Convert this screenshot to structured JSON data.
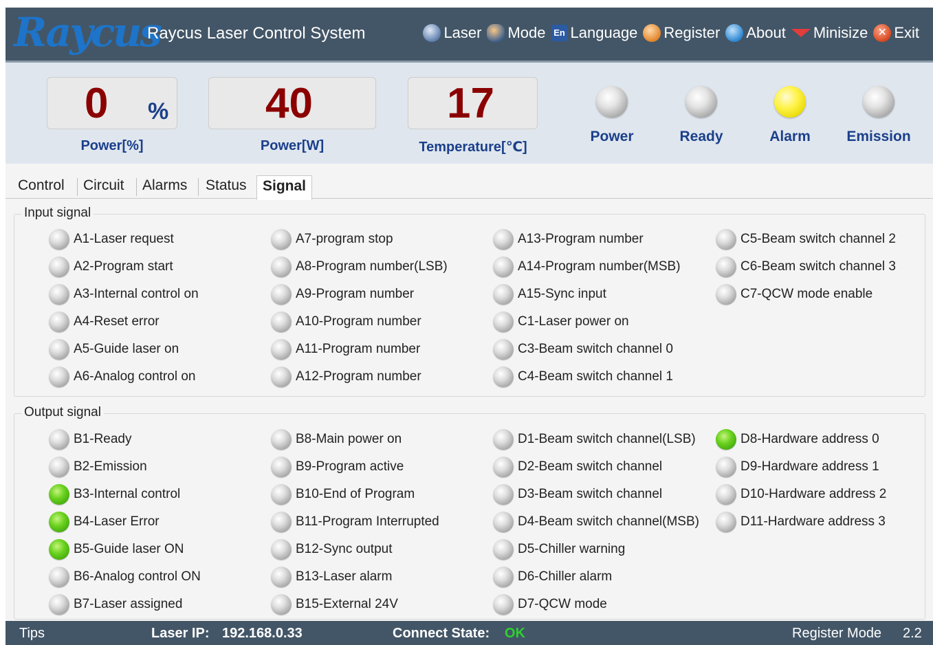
{
  "titlebar": {
    "logo_text": "Raycus",
    "app_title": "Raycus Laser Control System",
    "menu": [
      {
        "label": "Laser",
        "icon": "laser-icon"
      },
      {
        "label": "Mode",
        "icon": "mode-icon"
      },
      {
        "label": "Language",
        "icon": "language-icon",
        "badge": "En"
      },
      {
        "label": "Register",
        "icon": "register-icon"
      },
      {
        "label": "About",
        "icon": "about-icon"
      },
      {
        "label": "Minisize",
        "icon": "minimize-icon"
      },
      {
        "label": "Exit",
        "icon": "exit-icon"
      }
    ]
  },
  "gauges": {
    "power_percent": {
      "value": "0",
      "unit": "%",
      "label": "Power[%]"
    },
    "power_w": {
      "value": "40",
      "label": "Power[W]"
    },
    "temperature": {
      "value": "17",
      "label": "Temperature[℃]"
    },
    "indicators": [
      {
        "label": "Power",
        "state": "off"
      },
      {
        "label": "Ready",
        "state": "off"
      },
      {
        "label": "Alarm",
        "state": "yellow"
      },
      {
        "label": "Emission",
        "state": "off"
      }
    ]
  },
  "tabs": [
    {
      "label": "Control",
      "active": false
    },
    {
      "label": "Circuit",
      "active": false
    },
    {
      "label": "Alarms",
      "active": false
    },
    {
      "label": "Status",
      "active": false
    },
    {
      "label": "Signal",
      "active": true
    }
  ],
  "input_signal": {
    "title": "Input signal",
    "columns": [
      [
        {
          "label": "A1-Laser request",
          "on": false
        },
        {
          "label": "A2-Program start",
          "on": false
        },
        {
          "label": "A3-Internal control on",
          "on": false
        },
        {
          "label": "A4-Reset error",
          "on": false
        },
        {
          "label": "A5-Guide laser on",
          "on": false
        },
        {
          "label": "A6-Analog control on",
          "on": false
        }
      ],
      [
        {
          "label": "A7-program stop",
          "on": false
        },
        {
          "label": "A8-Program number(LSB)",
          "on": false
        },
        {
          "label": "A9-Program number",
          "on": false
        },
        {
          "label": "A10-Program number",
          "on": false
        },
        {
          "label": "A11-Program number",
          "on": false
        },
        {
          "label": "A12-Program number",
          "on": false
        }
      ],
      [
        {
          "label": "A13-Program number",
          "on": false
        },
        {
          "label": "A14-Program number(MSB)",
          "on": false
        },
        {
          "label": "A15-Sync input",
          "on": false
        },
        {
          "label": "C1-Laser power on",
          "on": false
        },
        {
          "label": "C3-Beam switch channel 0",
          "on": false
        },
        {
          "label": "C4-Beam switch channel 1",
          "on": false
        }
      ],
      [
        {
          "label": "C5-Beam switch channel 2",
          "on": false
        },
        {
          "label": "C6-Beam switch channel 3",
          "on": false
        },
        {
          "label": "C7-QCW mode enable",
          "on": false
        }
      ]
    ]
  },
  "output_signal": {
    "title": "Output signal",
    "columns": [
      [
        {
          "label": "B1-Ready",
          "on": false
        },
        {
          "label": "B2-Emission",
          "on": false
        },
        {
          "label": "B3-Internal control",
          "on": true
        },
        {
          "label": "B4-Laser Error",
          "on": true
        },
        {
          "label": "B5-Guide laser ON",
          "on": true
        },
        {
          "label": "B6-Analog control ON",
          "on": false
        },
        {
          "label": "B7-Laser assigned",
          "on": false
        }
      ],
      [
        {
          "label": "B8-Main power on",
          "on": false
        },
        {
          "label": "B9-Program active",
          "on": false
        },
        {
          "label": "B10-End of Program",
          "on": false
        },
        {
          "label": "B11-Program Interrupted",
          "on": false
        },
        {
          "label": "B12-Sync output",
          "on": false
        },
        {
          "label": "B13-Laser alarm",
          "on": false
        },
        {
          "label": "B15-External 24V",
          "on": false
        }
      ],
      [
        {
          "label": "D1-Beam switch channel(LSB)",
          "on": false
        },
        {
          "label": "D2-Beam switch channel",
          "on": false
        },
        {
          "label": "D3-Beam switch channel",
          "on": false
        },
        {
          "label": "D4-Beam switch channel(MSB)",
          "on": false
        },
        {
          "label": "D5-Chiller warning",
          "on": false
        },
        {
          "label": "D6-Chiller alarm",
          "on": false
        },
        {
          "label": "D7-QCW mode",
          "on": false
        }
      ],
      [
        {
          "label": "D8-Hardware address 0",
          "on": true
        },
        {
          "label": "D9-Hardware address 1",
          "on": false
        },
        {
          "label": "D10-Hardware address 2",
          "on": false
        },
        {
          "label": "D11-Hardware address 3",
          "on": false
        }
      ]
    ]
  },
  "statusbar": {
    "tips": "Tips",
    "ip_label": "Laser IP:",
    "ip_value": "192.168.0.33",
    "connect_label": "Connect State:",
    "connect_value": "OK",
    "register_mode": "Register Mode",
    "version": "2.2"
  },
  "colors": {
    "titlebar_bg": "#435667",
    "gauge_value": "#8b0000",
    "label_blue": "#1b3f8a",
    "led_green": "#52c019",
    "led_yellow": "#fff34a",
    "ok_green": "#2fd12f"
  }
}
